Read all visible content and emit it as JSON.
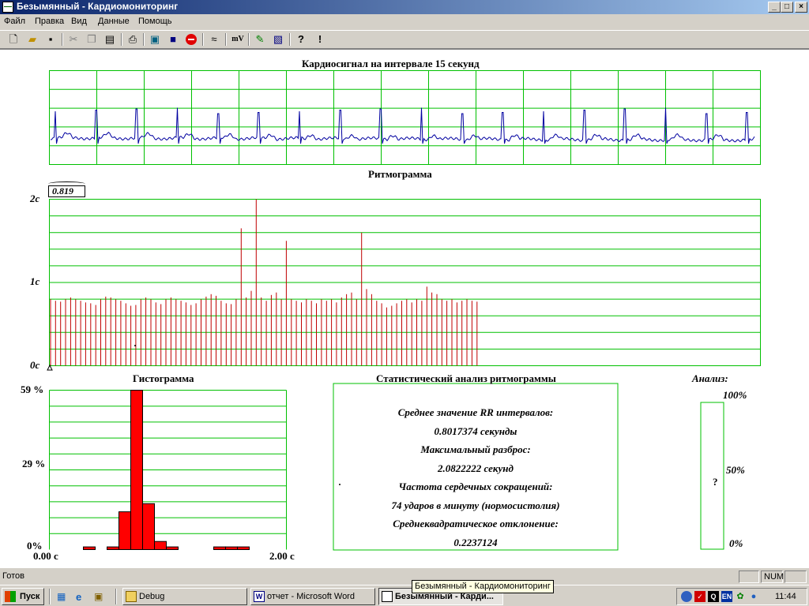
{
  "window": {
    "title": "Безымянный - Кардиомониторинг",
    "controls": [
      "_",
      "□",
      "×"
    ]
  },
  "menu": [
    "Файл",
    "Правка",
    "Вид",
    "Данные",
    "Помощь"
  ],
  "toolbar": {
    "icons": [
      "new-file-icon",
      "open-folder-icon",
      "save-icon",
      "cut-icon",
      "copy-icon",
      "paste-icon",
      "print-icon",
      "monitor-icon",
      "disk-icon",
      "stop-icon",
      "wave-icon",
      "mv-icon",
      "pen-icon",
      "document-icon",
      "help-icon",
      "context-help-icon"
    ],
    "mv_label": "mV"
  },
  "cardio": {
    "title": "Кардиосигнал на интервале 15 секунд"
  },
  "rhythm": {
    "title": "Ритмограмма",
    "cursor_value": "0.819",
    "y_labels": [
      "2с",
      "1с",
      "0с"
    ],
    "chart_data": {
      "type": "bar",
      "ylim": [
        0,
        2
      ],
      "values": [
        0.8,
        0.78,
        0.77,
        0.8,
        0.82,
        0.8,
        0.78,
        0.76,
        0.75,
        0.73,
        0.8,
        0.83,
        0.82,
        0.8,
        0.78,
        0.75,
        0.72,
        0.73,
        0.8,
        0.82,
        0.8,
        0.76,
        0.74,
        0.8,
        0.82,
        0.8,
        0.78,
        0.76,
        0.73,
        0.75,
        0.8,
        0.83,
        0.86,
        0.84,
        0.78,
        0.75,
        0.74,
        0.8,
        1.65,
        0.82,
        0.9,
        2.0,
        0.82,
        0.78,
        0.85,
        0.88,
        0.8,
        1.5,
        0.8,
        0.78,
        0.76,
        0.8,
        0.78,
        0.75,
        0.8,
        0.78,
        0.8,
        0.76,
        0.82,
        0.86,
        0.88,
        0.8,
        1.6,
        0.92,
        0.86,
        0.78,
        0.75,
        0.7,
        0.72,
        0.75,
        0.78,
        0.8,
        0.76,
        0.8,
        0.78,
        0.95,
        0.88,
        0.86,
        0.8,
        0.78,
        0.8,
        0.76,
        0.78,
        0.8,
        0.78,
        0.77
      ]
    }
  },
  "histogram": {
    "title": "Гистограмма",
    "y_labels": [
      "59 %",
      "29 %",
      "0%"
    ],
    "x_labels": [
      "0.00 с",
      "2.00 с"
    ],
    "chart_data": {
      "type": "bar",
      "ylim": [
        0,
        59
      ],
      "xlim": [
        0,
        2
      ],
      "bins": [
        {
          "x": 0.3,
          "value": 1
        },
        {
          "x": 0.5,
          "value": 1
        },
        {
          "x": 0.6,
          "value": 14
        },
        {
          "x": 0.7,
          "value": 59
        },
        {
          "x": 0.8,
          "value": 17
        },
        {
          "x": 0.9,
          "value": 3
        },
        {
          "x": 1.0,
          "value": 1
        },
        {
          "x": 1.4,
          "value": 1
        },
        {
          "x": 1.5,
          "value": 1
        },
        {
          "x": 1.6,
          "value": 1
        }
      ]
    }
  },
  "stats": {
    "title": "Статистический анализ ритмограммы",
    "lines": [
      "Среднее значение RR интервалов:",
      "0.8017374 секунды",
      "Максимальный разброс:",
      "2.0822222 секунд",
      "Частота сердечных сокращений:",
      "74 ударов в минуту (нормосистолия)",
      "Среднеквадратическое отклонение:",
      "0.2237124"
    ]
  },
  "analysis": {
    "title": "Анализ:",
    "scale": [
      "100%",
      "50%",
      "0%"
    ],
    "value": "?"
  },
  "statusbar": {
    "text": "Готов",
    "num": "NUM"
  },
  "taskbar": {
    "start": "Пуск",
    "tasks": [
      "Debug",
      "отчет - Microsoft Word",
      "Безымянный - Карди..."
    ],
    "tooltip": "Безымянный - Кардиомониторинг",
    "lang": "EN",
    "clock": "11:44"
  },
  "colors": {
    "grid": "#00c000",
    "ecg": "#0000a0",
    "bars": "#c00000",
    "hist": "#ff0000"
  }
}
